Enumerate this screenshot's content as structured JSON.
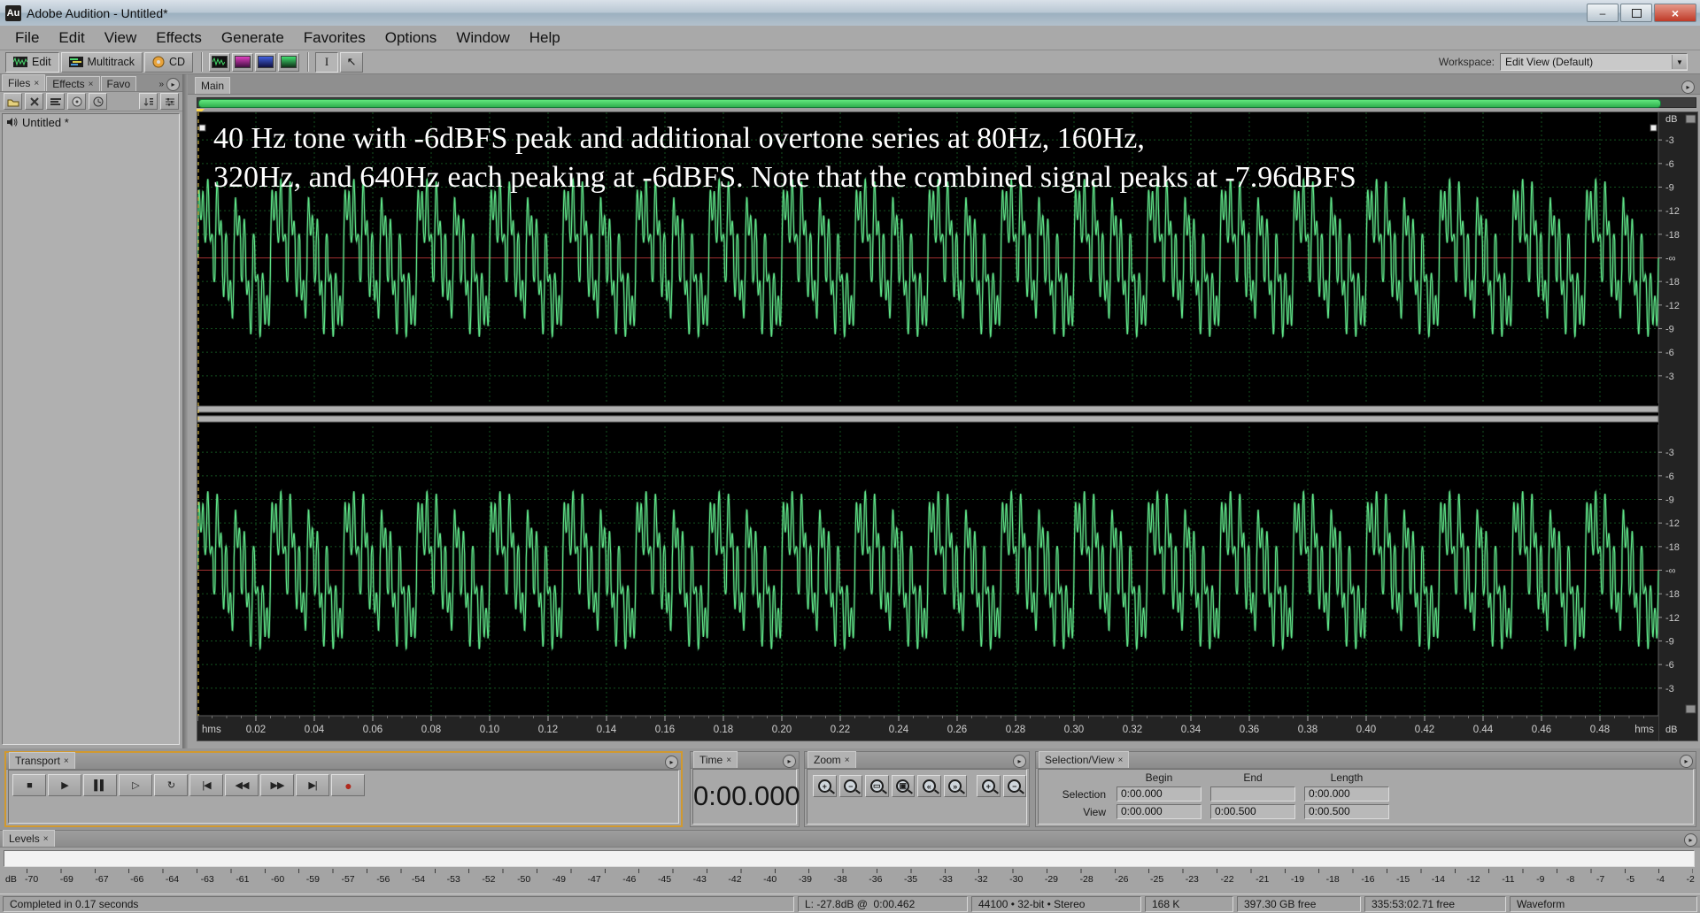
{
  "window": {
    "icon_label": "Au",
    "title": "Adobe Audition - Untitled*"
  },
  "menu": {
    "items": [
      "File",
      "Edit",
      "View",
      "Effects",
      "Generate",
      "Favorites",
      "Options",
      "Window",
      "Help"
    ]
  },
  "toolbar": {
    "view_buttons": [
      {
        "label": "Edit"
      },
      {
        "label": "Multitrack"
      },
      {
        "label": "CD"
      }
    ],
    "workspace_label": "Workspace:",
    "workspace_value": "Edit View (Default)"
  },
  "files_panel": {
    "tabs": [
      "Files",
      "Effects",
      "Favo"
    ],
    "items": [
      {
        "name": "Untitled *"
      }
    ]
  },
  "main_panel": {
    "tab": "Main"
  },
  "waveform": {
    "annotation_line1": "40 Hz tone with -6dBFS peak and additional overtone series at 80Hz, 160Hz,",
    "annotation_line2": "320Hz, and 640Hz each peaking at -6dBFS. Note that the combined signal peaks at -7.96dBFS",
    "fundamental_hz": 40,
    "overtones_hz": [
      80,
      160,
      320,
      640
    ],
    "component_peak_db": -6,
    "combined_peak_db": -7.96,
    "duration_s": 0.5,
    "channels": 2,
    "ruler_unit": "dB",
    "time_unit": "hms",
    "db_scale_labels": [
      "-3",
      "-6",
      "-9",
      "-12",
      "-18",
      "-∞",
      "-18",
      "-12",
      "-9",
      "-6",
      "-3"
    ],
    "time_labels": [
      "0.02",
      "0.04",
      "0.06",
      "0.08",
      "0.10",
      "0.12",
      "0.14",
      "0.16",
      "0.18",
      "0.20",
      "0.22",
      "0.24",
      "0.26",
      "0.28",
      "0.30",
      "0.32",
      "0.34",
      "0.36",
      "0.38",
      "0.40",
      "0.42",
      "0.44",
      "0.46",
      "0.48"
    ],
    "colors": {
      "wave": "#5fe287",
      "grid": "#14521f",
      "background": "#000000",
      "center_line": "#a03030",
      "cursor": "#ffd94f",
      "range_bar": "#3fd96a"
    }
  },
  "transport": {
    "tab": "Transport",
    "buttons": [
      {
        "name": "stop-button",
        "glyph": "■"
      },
      {
        "name": "play-button",
        "glyph": "▶"
      },
      {
        "name": "pause-button",
        "glyph": "▌▌"
      },
      {
        "name": "play-from-cursor-button",
        "glyph": "▷"
      },
      {
        "name": "play-looped-button",
        "glyph": "↻"
      },
      {
        "name": "go-to-beginning-button",
        "glyph": "|◀"
      },
      {
        "name": "rewind-button",
        "glyph": "◀◀"
      },
      {
        "name": "fast-forward-button",
        "glyph": "▶▶"
      },
      {
        "name": "go-to-end-button",
        "glyph": "▶|"
      },
      {
        "name": "record-button",
        "glyph": "●",
        "color": "#b02a1e"
      }
    ]
  },
  "time_panel": {
    "tab": "Time",
    "value": "0:00.000"
  },
  "zoom_panel": {
    "tab": "Zoom",
    "buttons": [
      {
        "name": "zoom-in-horizontal-button",
        "sign": "+"
      },
      {
        "name": "zoom-out-horizontal-button",
        "sign": "−"
      },
      {
        "name": "zoom-full-button",
        "sign": "▭"
      },
      {
        "name": "zoom-to-selection-button",
        "sign": "▣"
      },
      {
        "name": "zoom-in-left-edge-button",
        "sign": "«"
      },
      {
        "name": "zoom-in-right-edge-button",
        "sign": "»"
      },
      {
        "name": "zoom-in-vertical-button",
        "sign": "+"
      },
      {
        "name": "zoom-out-vertical-button",
        "sign": "−"
      }
    ]
  },
  "selection_view": {
    "tab": "Selection/View",
    "columns": [
      "Begin",
      "End",
      "Length"
    ],
    "rows": [
      {
        "label": "Selection",
        "begin": "0:00.000",
        "end": "",
        "length": "0:00.000"
      },
      {
        "label": "View",
        "begin": "0:00.000",
        "end": "0:00.500",
        "length": "0:00.500"
      }
    ]
  },
  "levels": {
    "tab": "Levels",
    "unit": "dB",
    "scale": [
      "-70",
      "-69",
      "-67",
      "-66",
      "-64",
      "-63",
      "-61",
      "-60",
      "-59",
      "-57",
      "-56",
      "-54",
      "-53",
      "-52",
      "-50",
      "-49",
      "-47",
      "-46",
      "-45",
      "-43",
      "-42",
      "-40",
      "-39",
      "-38",
      "-36",
      "-35",
      "-33",
      "-32",
      "-30",
      "-29",
      "-28",
      "-26",
      "-25",
      "-23",
      "-22",
      "-21",
      "-19",
      "-18",
      "-16",
      "-15",
      "-14",
      "-12",
      "-11",
      "-9",
      "-8",
      "-7",
      "-5",
      "-4",
      "-2"
    ]
  },
  "status_bar": {
    "message": "Completed in 0.17 seconds",
    "cells": [
      "L: -27.8dB @  0:00.462",
      "44100 • 32-bit • Stereo",
      "168 K",
      "397.30 GB free",
      "335:53:02.71 free",
      "Waveform"
    ]
  }
}
